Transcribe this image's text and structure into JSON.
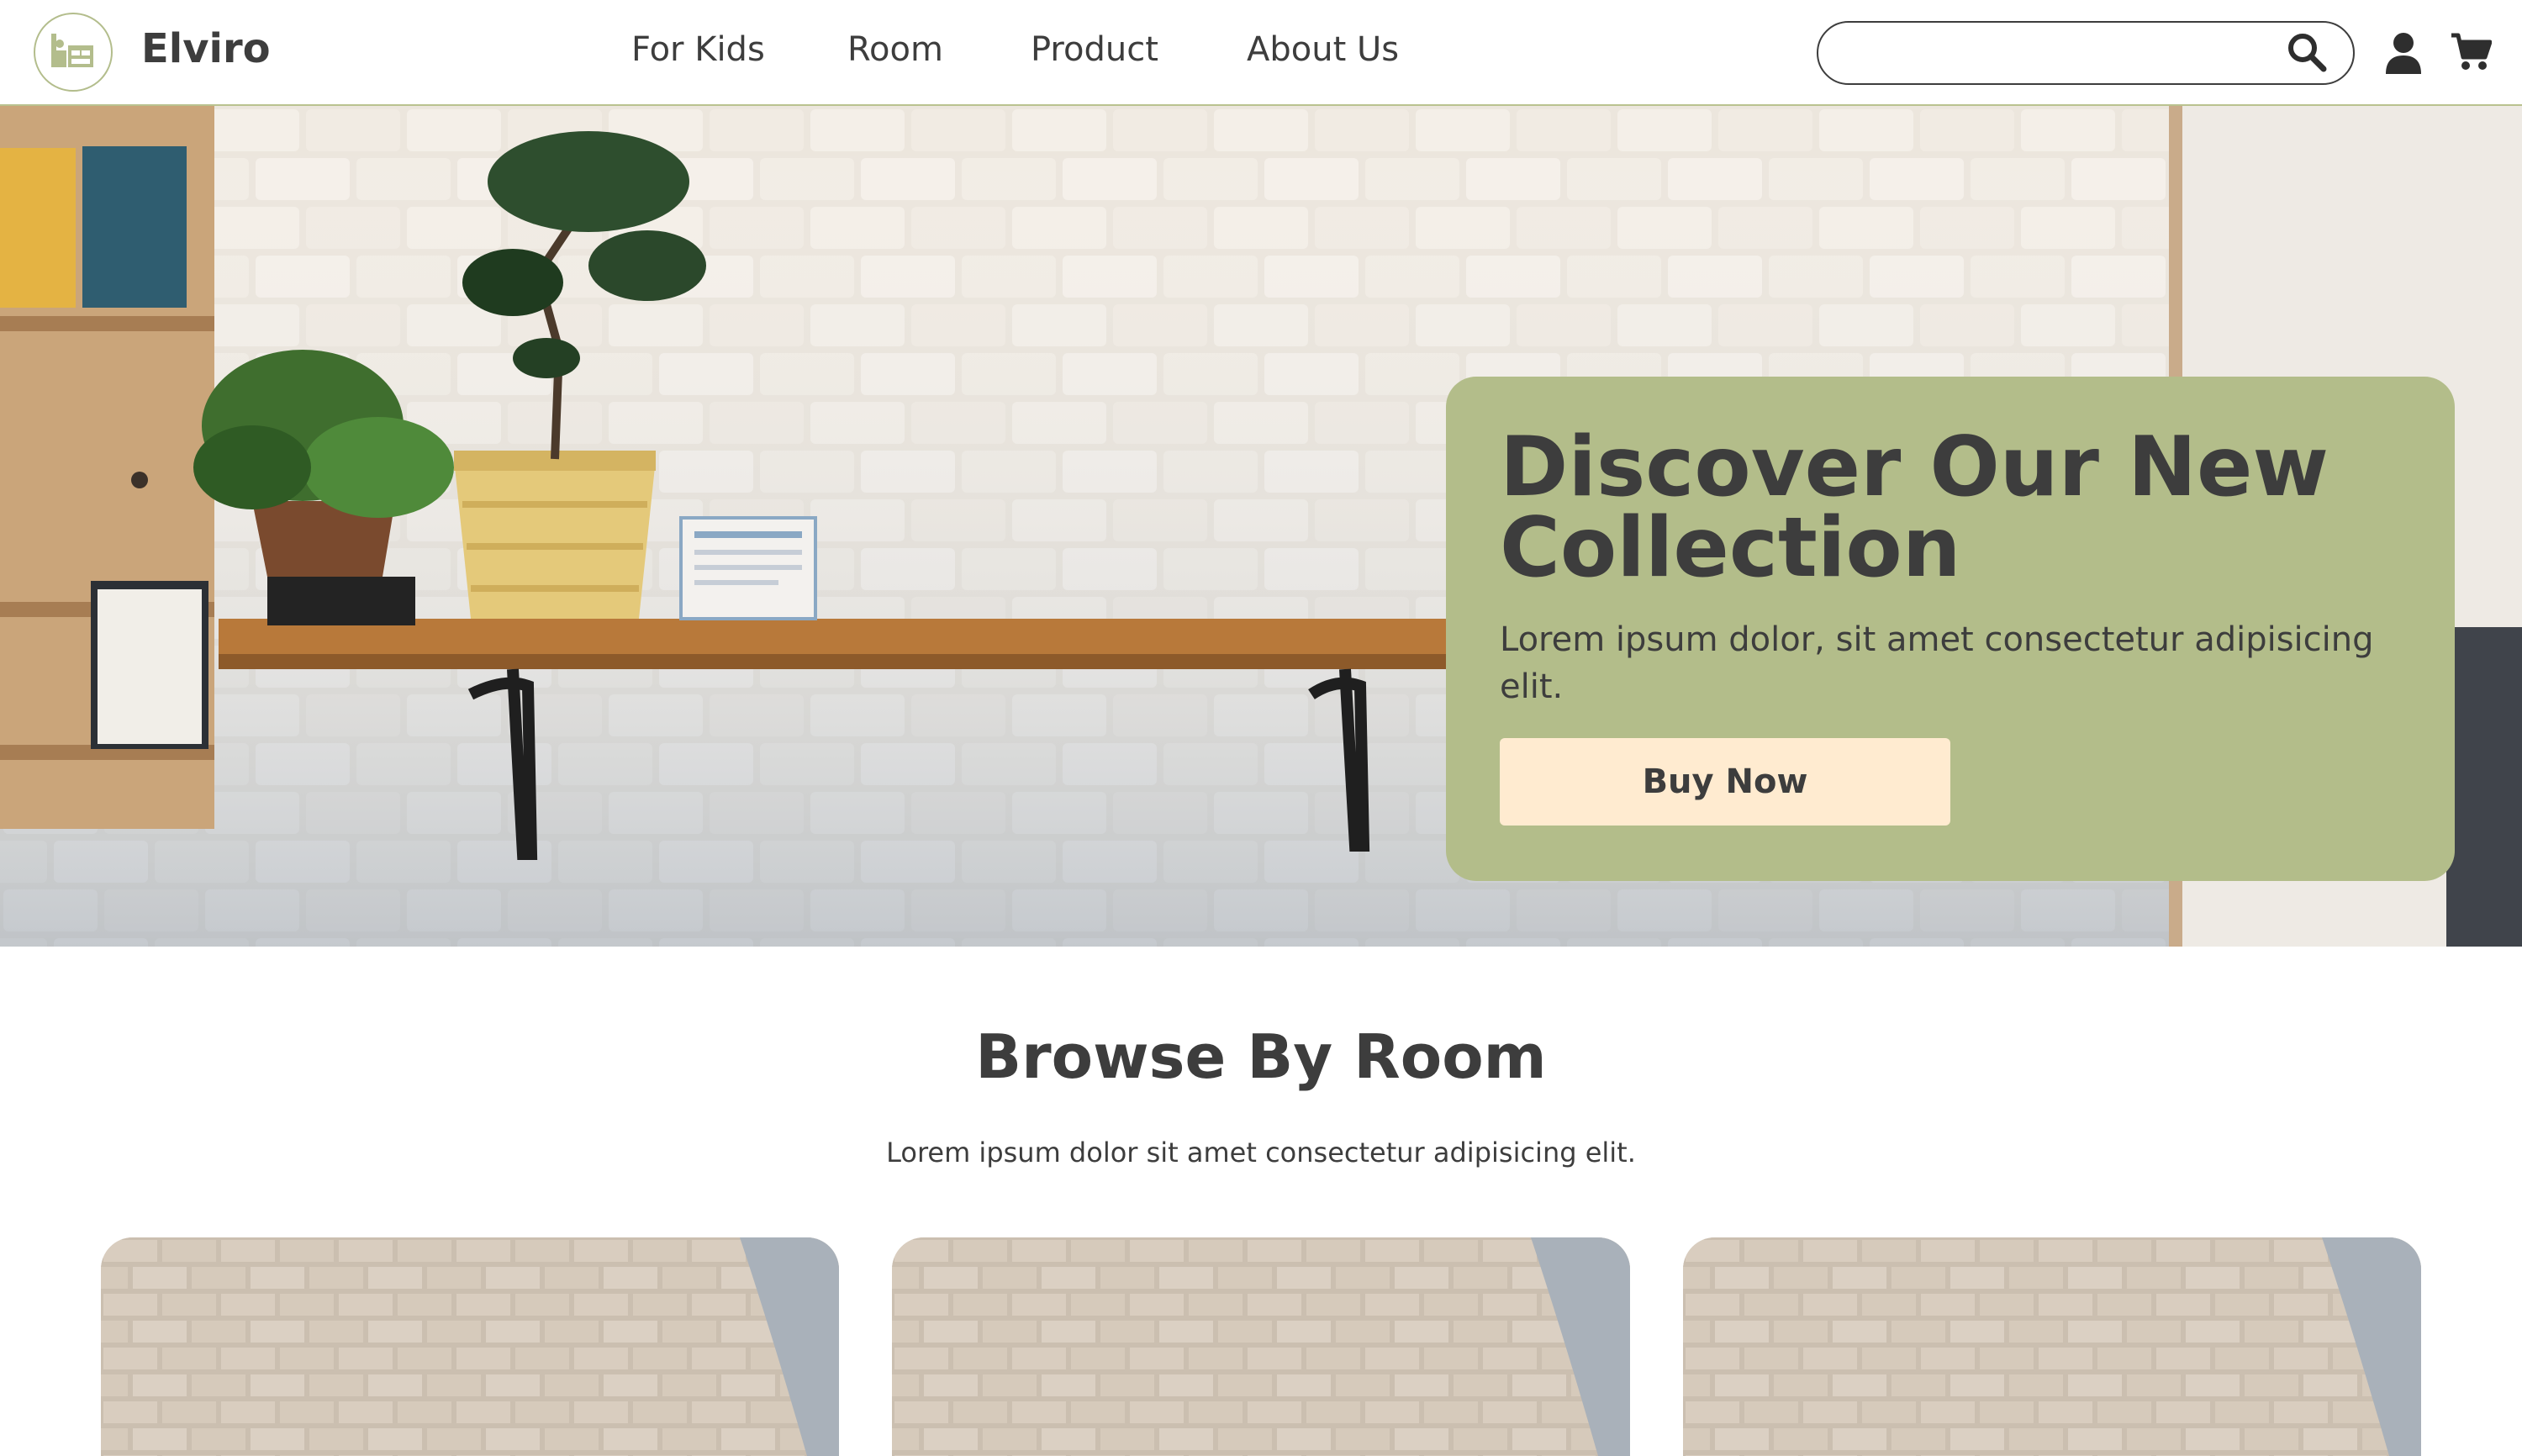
{
  "header": {
    "brand": "Elviro",
    "nav": [
      "For Kids",
      "Room",
      "Product",
      "About Us"
    ],
    "search": {
      "placeholder": ""
    },
    "icons": [
      "search-icon",
      "user-icon",
      "cart-icon"
    ]
  },
  "hero": {
    "title": "Discover Our New Collection",
    "subtitle": "Lorem ipsum dolor, sit amet consectetur adipisicing elit.",
    "button": "Buy Now"
  },
  "browse": {
    "title": "Browse By Room",
    "subtitle": "Lorem ipsum dolor sit amet consectetur adipisicing elit."
  },
  "colors": {
    "accent": "#b3bd8a",
    "button_bg": "#ffebd0",
    "text": "#3d3d3d"
  }
}
